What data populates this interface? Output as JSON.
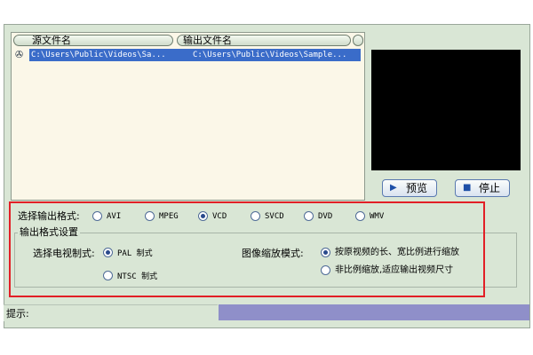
{
  "file_list": {
    "columns": [
      "源文件名",
      "输出文件名"
    ],
    "rows": [
      {
        "source": "C:\\Users\\Public\\Videos\\Sa...",
        "output": "C:\\Users\\Public\\Videos\\Sample..."
      }
    ]
  },
  "buttons": {
    "preview": "预览",
    "stop": "停止"
  },
  "output_format": {
    "label": "选择输出格式:",
    "options": [
      "AVI",
      "MPEG",
      "VCD",
      "SVCD",
      "DVD",
      "WMV"
    ],
    "selected": "VCD"
  },
  "format_settings": {
    "legend": "输出格式设置",
    "tv_standard": {
      "label": "选择电视制式:",
      "options": [
        "PAL 制式",
        "NTSC 制式"
      ],
      "selected": "PAL 制式"
    },
    "scale_mode": {
      "label": "图像缩放模式:",
      "options": [
        "按原视频的长、宽比例进行缩放",
        "非比例缩放,适应输出视频尺寸"
      ],
      "selected": "按原视频的长、宽比例进行缩放"
    }
  },
  "status_bar": {
    "hint_label": "提示:"
  },
  "colors": {
    "window_bg": "#d9e6d5",
    "selection": "#3a6cc9",
    "highlight_box": "#e21f26",
    "status_right": "#8f8fc9"
  },
  "icons": [
    "film-icon",
    "play-icon",
    "stop-icon"
  ]
}
